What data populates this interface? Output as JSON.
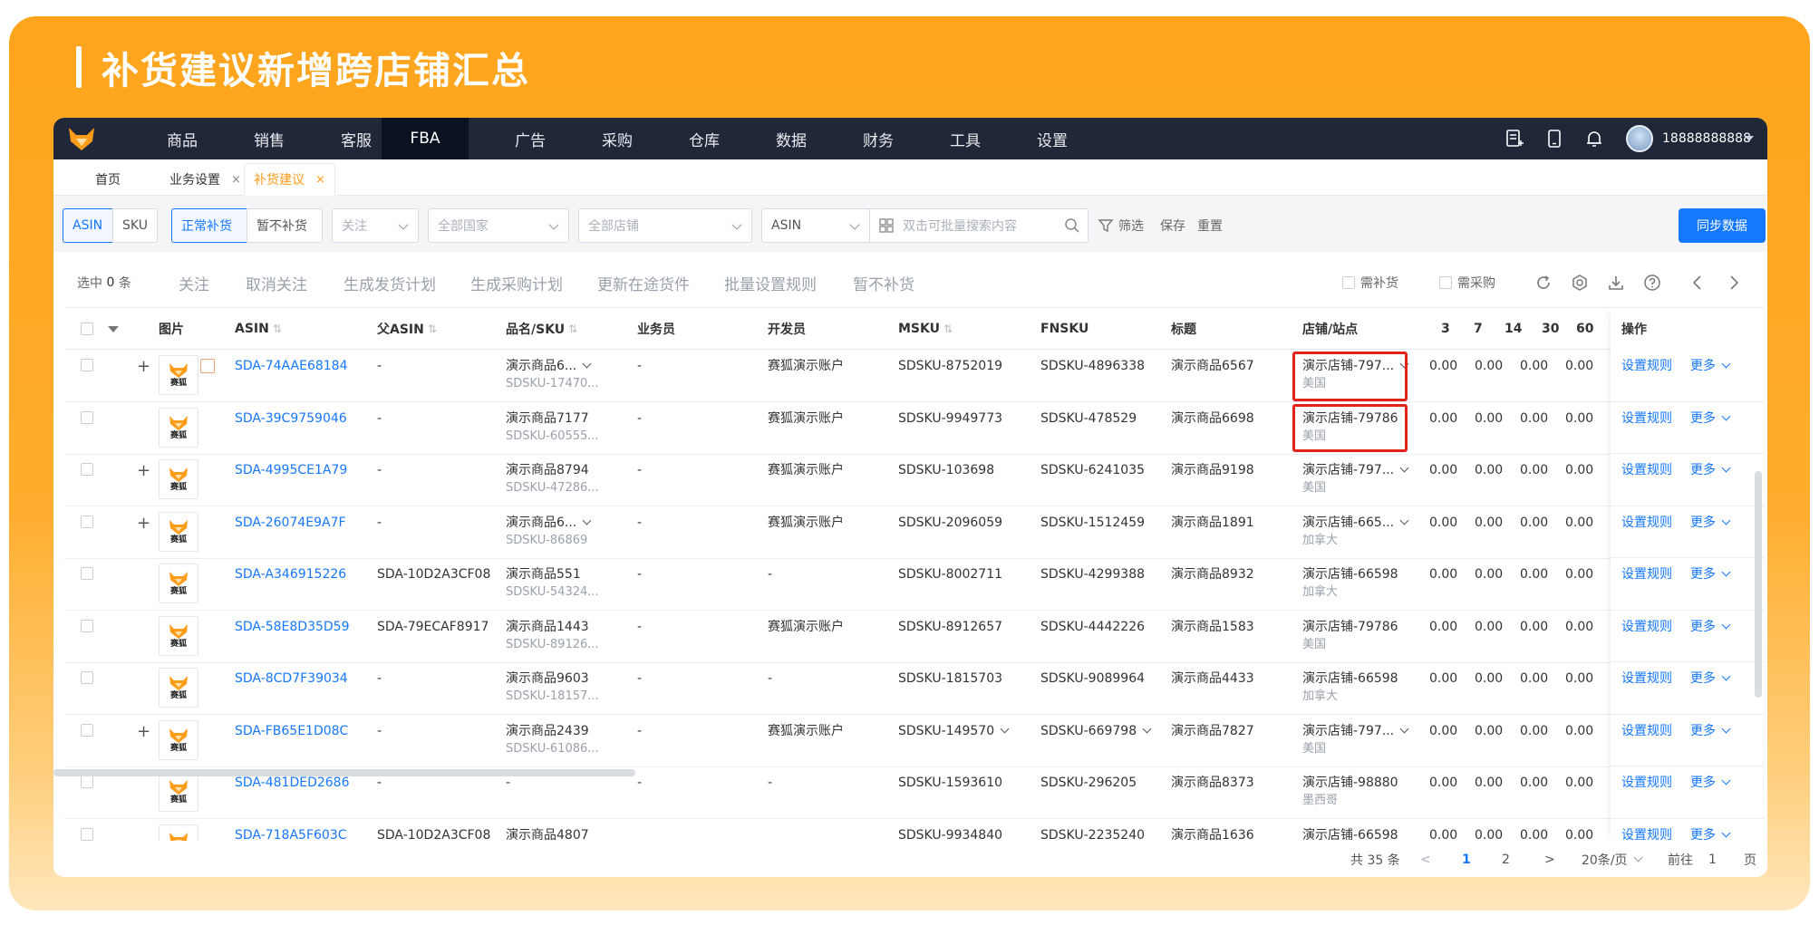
{
  "banner": {
    "title": "补货建议新增跨店铺汇总"
  },
  "topnav": {
    "items": [
      "商品",
      "销售",
      "客服",
      "FBA",
      "广告",
      "采购",
      "仓库",
      "数据",
      "财务",
      "工具",
      "设置"
    ],
    "active": "FBA",
    "username": "18888888888"
  },
  "tabs": [
    {
      "label": "首页",
      "closable": false
    },
    {
      "label": "业务设置",
      "closable": true
    },
    {
      "label": "补货建议",
      "closable": true,
      "active": true
    }
  ],
  "tab_close": "×",
  "filters": {
    "asin_toggle": "ASIN",
    "sku_toggle": "SKU",
    "normal_replenish": "正常补货",
    "pause_replenish": "暂不补货",
    "follow_placeholder": "关注",
    "country_placeholder": "全部国家",
    "shop_placeholder": "全部店铺",
    "search_type": "ASIN",
    "search_placeholder": "双击可批量搜索内容",
    "filter_label": "筛选",
    "save_label": "保存",
    "reset_label": "重置",
    "sync_button": "同步数据"
  },
  "actions": {
    "selected_prefix": "选中",
    "selected_count": "0",
    "selected_suffix": "条",
    "items": [
      "关注",
      "取消关注",
      "生成发货计划",
      "生成采购计划",
      "更新在途货件",
      "批量设置规则",
      "暂不补货"
    ],
    "need_replenish": "需补货",
    "need_purchase": "需采购"
  },
  "table": {
    "headers": {
      "image": "图片",
      "asin": "ASIN",
      "parent_asin": "父ASIN",
      "name_sku": "品名/SKU",
      "salesman": "业务员",
      "developer": "开发员",
      "msku": "MSKU",
      "fnsku": "FNSKU",
      "title": "标题",
      "shop_site": "店铺/站点",
      "d3": "3",
      "d7": "7",
      "d14": "14",
      "d30": "30",
      "d60": "60",
      "ops": "操作"
    },
    "sort_glyph": "⇅",
    "brand_text": "赛狐",
    "op_rule": "设置规则",
    "op_more": "更多",
    "rows": [
      {
        "expand": "+",
        "asin": "SDA-74AAE68184",
        "parent": "-",
        "name": "演示商品6...",
        "sku": "SDSKU-17470...",
        "name_dd": true,
        "salesman": "-",
        "developer": "赛狐演示账户",
        "msku": "SDSKU-8752019",
        "msku_dd": false,
        "fnsku": "SDSKU-4896338",
        "fnsku_dd": false,
        "title": "演示商品6567",
        "shop": "演示店铺-797...",
        "shop_dd": true,
        "site": "美国",
        "d3": "0.00",
        "d7": "0.00",
        "d14": "0.00",
        "d30": "0.00",
        "tag": true
      },
      {
        "expand": "",
        "asin": "SDA-39C9759046",
        "parent": "-",
        "name": "演示商品7177",
        "sku": "SDSKU-60555...",
        "name_dd": false,
        "salesman": "-",
        "developer": "赛狐演示账户",
        "msku": "SDSKU-9949773",
        "msku_dd": false,
        "fnsku": "SDSKU-478529",
        "fnsku_dd": false,
        "title": "演示商品6698",
        "shop": "演示店铺-79786",
        "shop_dd": false,
        "site": "美国",
        "d3": "0.00",
        "d7": "0.00",
        "d14": "0.00",
        "d30": "0.00",
        "tag": false
      },
      {
        "expand": "+",
        "asin": "SDA-4995CE1A79",
        "parent": "-",
        "name": "演示商品8794",
        "sku": "SDSKU-47286...",
        "name_dd": false,
        "salesman": "-",
        "developer": "赛狐演示账户",
        "msku": "SDSKU-103698",
        "msku_dd": false,
        "fnsku": "SDSKU-6241035",
        "fnsku_dd": false,
        "title": "演示商品9198",
        "shop": "演示店铺-797...",
        "shop_dd": true,
        "site": "美国",
        "d3": "0.00",
        "d7": "0.00",
        "d14": "0.00",
        "d30": "0.00",
        "tag": false
      },
      {
        "expand": "+",
        "asin": "SDA-26074E9A7F",
        "parent": "-",
        "name": "演示商品6...",
        "sku": "SDSKU-86869",
        "name_dd": true,
        "salesman": "-",
        "developer": "赛狐演示账户",
        "msku": "SDSKU-2096059",
        "msku_dd": false,
        "fnsku": "SDSKU-1512459",
        "fnsku_dd": false,
        "title": "演示商品1891",
        "shop": "演示店铺-665...",
        "shop_dd": true,
        "site": "加拿大",
        "d3": "0.00",
        "d7": "0.00",
        "d14": "0.00",
        "d30": "0.00",
        "tag": false
      },
      {
        "expand": "",
        "asin": "SDA-A346915226",
        "parent": "SDA-10D2A3CF08",
        "name": "演示商品551",
        "sku": "SDSKU-54324...",
        "name_dd": false,
        "salesman": "-",
        "developer": "-",
        "msku": "SDSKU-8002711",
        "msku_dd": false,
        "fnsku": "SDSKU-4299388",
        "fnsku_dd": false,
        "title": "演示商品8932",
        "shop": "演示店铺-66598",
        "shop_dd": false,
        "site": "加拿大",
        "d3": "0.00",
        "d7": "0.00",
        "d14": "0.00",
        "d30": "0.00",
        "tag": false
      },
      {
        "expand": "",
        "asin": "SDA-58E8D35D59",
        "parent": "SDA-79ECAF8917",
        "name": "演示商品1443",
        "sku": "SDSKU-89126...",
        "name_dd": false,
        "salesman": "-",
        "developer": "赛狐演示账户",
        "msku": "SDSKU-8912657",
        "msku_dd": false,
        "fnsku": "SDSKU-4442226",
        "fnsku_dd": false,
        "title": "演示商品1583",
        "shop": "演示店铺-79786",
        "shop_dd": false,
        "site": "美国",
        "d3": "0.00",
        "d7": "0.00",
        "d14": "0.00",
        "d30": "0.00",
        "tag": false
      },
      {
        "expand": "",
        "asin": "SDA-8CD7F39034",
        "parent": "-",
        "name": "演示商品9603",
        "sku": "SDSKU-18157...",
        "name_dd": false,
        "salesman": "-",
        "developer": "-",
        "msku": "SDSKU-1815703",
        "msku_dd": false,
        "fnsku": "SDSKU-9089964",
        "fnsku_dd": false,
        "title": "演示商品4433",
        "shop": "演示店铺-66598",
        "shop_dd": false,
        "site": "加拿大",
        "d3": "0.00",
        "d7": "0.00",
        "d14": "0.00",
        "d30": "0.00",
        "tag": false
      },
      {
        "expand": "+",
        "asin": "SDA-FB65E1D08C",
        "parent": "-",
        "name": "演示商品2439",
        "sku": "SDSKU-61086...",
        "name_dd": false,
        "salesman": "-",
        "developer": "赛狐演示账户",
        "msku": "SDSKU-149570",
        "msku_dd": true,
        "fnsku": "SDSKU-669798",
        "fnsku_dd": true,
        "title": "演示商品7827",
        "shop": "演示店铺-797...",
        "shop_dd": true,
        "site": "美国",
        "d3": "0.00",
        "d7": "0.00",
        "d14": "0.00",
        "d30": "0.00",
        "tag": false
      },
      {
        "expand": "",
        "asin": "SDA-481DED2686",
        "parent": "-",
        "name": "-",
        "sku": "",
        "name_dd": false,
        "salesman": "-",
        "developer": "-",
        "msku": "SDSKU-1593610",
        "msku_dd": false,
        "fnsku": "SDSKU-296205",
        "fnsku_dd": false,
        "title": "演示商品8373",
        "shop": "演示店铺-98880",
        "shop_dd": false,
        "site": "墨西哥",
        "d3": "0.00",
        "d7": "0.00",
        "d14": "0.00",
        "d30": "0.00",
        "tag": false
      },
      {
        "expand": "",
        "asin": "SDA-718A5F603C",
        "parent": "SDA-10D2A3CF08",
        "name": "演示商品4807",
        "sku": "",
        "name_dd": false,
        "salesman": "",
        "developer": "",
        "msku": "SDSKU-9934840",
        "msku_dd": false,
        "fnsku": "SDSKU-2235240",
        "fnsku_dd": false,
        "title": "演示商品1636",
        "shop": "演示店铺-66598",
        "shop_dd": false,
        "site": "",
        "d3": "0.00",
        "d7": "0.00",
        "d14": "0.00",
        "d30": "0.00",
        "tag": false
      }
    ]
  },
  "pagination": {
    "total": "共 35 条",
    "prev": "<",
    "pages": [
      "1",
      "2"
    ],
    "current": "1",
    "next": ">",
    "page_size": "20条/页",
    "goto_prefix": "前往",
    "goto_value": "1",
    "goto_suffix": "页"
  },
  "colors": {
    "brand_orange": "#ffa41c",
    "primary_blue": "#1677ff",
    "nav_dark": "#1f2738",
    "highlight_red": "#e2231a"
  }
}
